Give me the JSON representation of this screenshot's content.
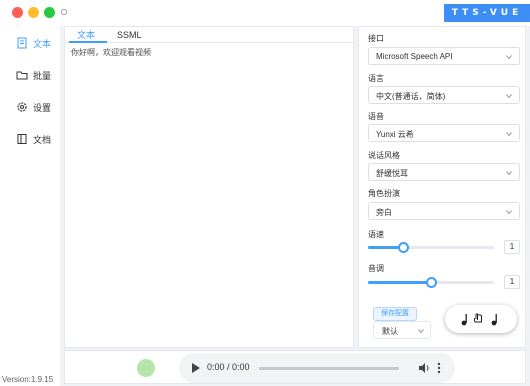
{
  "brand": "TTS-VUE",
  "sidebar": {
    "items": [
      {
        "label": "文本",
        "icon": "document-icon",
        "active": true
      },
      {
        "label": "批量",
        "icon": "folder-icon",
        "active": false
      },
      {
        "label": "设置",
        "icon": "gear-icon",
        "active": false
      },
      {
        "label": "文档",
        "icon": "book-icon",
        "active": false
      }
    ],
    "version": "Version:1.9.15"
  },
  "editor": {
    "tabs": [
      "文本",
      "SSML"
    ],
    "active_tab": "文本",
    "text": "你好啊，欢迎观看视频"
  },
  "settings": {
    "api": {
      "label": "接口",
      "value": "Microsoft Speech API"
    },
    "language": {
      "label": "语言",
      "value": "中文(普通话，简体)"
    },
    "voice": {
      "label": "语音",
      "value": "Yunxi 云希"
    },
    "style": {
      "label": "说话风格",
      "value": "舒缓悦耳"
    },
    "role": {
      "label": "角色扮演",
      "value": "旁白"
    },
    "rate": {
      "label": "语速",
      "value": "1",
      "fraction": 0.28
    },
    "pitch": {
      "label": "音调",
      "value": "1",
      "fraction": 0.5
    },
    "save_config": "保存配置",
    "preset": "默认"
  },
  "player": {
    "time": "0:00 / 0:00"
  },
  "colors": {
    "accent": "#409eff",
    "brand_bg": "#3d8ef5"
  }
}
